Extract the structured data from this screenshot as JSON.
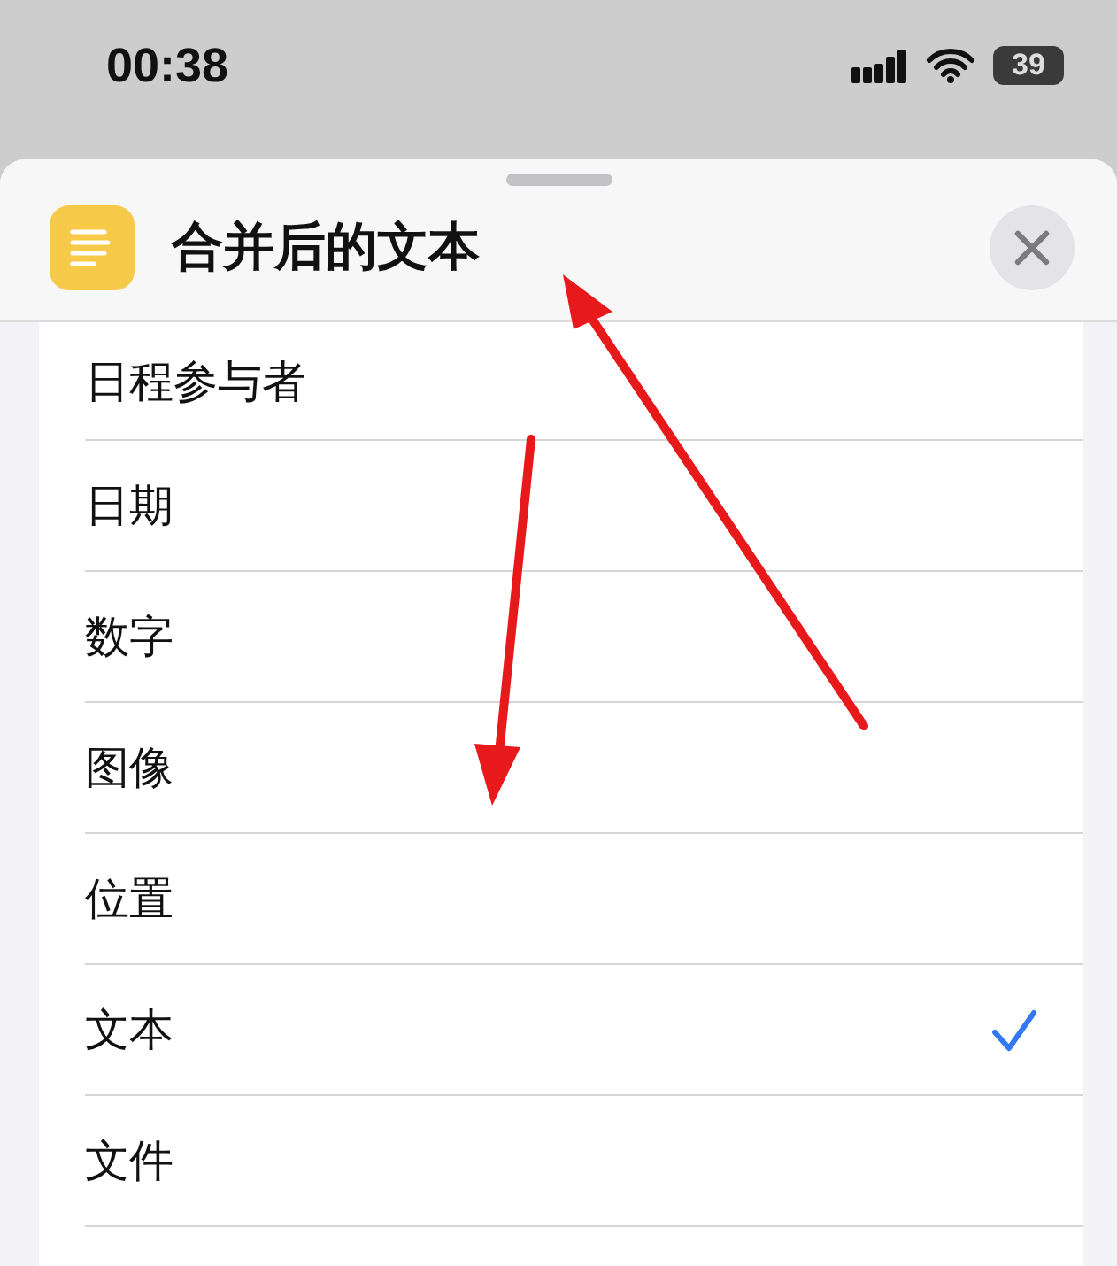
{
  "status_bar": {
    "time": "00:38",
    "battery": "39"
  },
  "sheet": {
    "title": "合并后的文本"
  },
  "items": [
    {
      "label": "日程参与者",
      "selected": false
    },
    {
      "label": "日期",
      "selected": false
    },
    {
      "label": "数字",
      "selected": false
    },
    {
      "label": "图像",
      "selected": false
    },
    {
      "label": "位置",
      "selected": false
    },
    {
      "label": "文本",
      "selected": true
    },
    {
      "label": "文件",
      "selected": false
    }
  ]
}
